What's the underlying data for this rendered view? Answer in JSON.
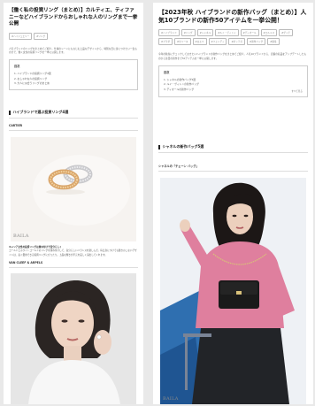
{
  "left_article": {
    "title": "【働く私の投資リング（まとめ）】カルティエ、ティファニーなどハイブランドからおしゃれな人のリングまで一挙公開",
    "tags": [
      "#ハイジュエリー",
      "#リング"
    ],
    "lead": "人気ブランドのリングをまとめてご紹介。仕事のシーンにもなじむ上品なデザインから、特別な日に身につけたい一生ものまで、働く女性の投資リングを一挙に公開します。",
    "toc": {
      "heading": "目次",
      "items": [
        "1. ハイブランドの投資リング4選",
        "2. おしゃれな人の投資リング",
        "3. 大人に似合うリングのまとめ"
      ]
    },
    "section1": "ハイブランドで選ぶ投資リング4選",
    "sub1": "CARTIER",
    "photo1_logo": "BAILA",
    "caption1": {
      "bold": "キャリア女性の投資リングは重ね付けで自分らしく",
      "text": "ゴールドとホワイトゴールドのリングを重ね付けして、自分らしいバランスを楽しんで。毎日身につけても飽きのこないデザインは、長く愛用できる投資リングにぴったり。上品な輝きが手元を美しく演出してくれます。"
    },
    "sub2": "VAN CLEEF & ARPELS"
  },
  "right_article": {
    "title": "【2023年秋 ハイブランドの新作バッグ（まとめ）】人気10ブランドの新作50アイテムを一挙公開！",
    "tags": [
      "#ハイブランド",
      "#バッグ",
      "#シャネル",
      "#ルイ・ヴィトン",
      "#ディオール",
      "#エルメス",
      "#グッチ",
      "#プラダ",
      "#セリーヌ",
      "#ロエベ",
      "#フェンディ",
      "#ボッテガ",
      "#新作バッグ",
      "#秋冬"
    ],
    "lead": "今年の秋冬にチェックしておきたいハイブランドの新作バッグをまとめてご紹介。人気10ブランドから、定番の名品をアップデートしたものから注目の新作まで50アイテムを一挙に公開します。",
    "toc": {
      "heading": "目次",
      "items": [
        "1. シャネルの新作バッグ5選",
        "2. ルイ・ヴィトンの新作バッグ",
        "3. ディオールの新作バッグ"
      ],
      "more": "すべて見る"
    },
    "section1": "シャネルの新作バッグ5選",
    "sub1": "シャネルの「チェーン バッグ」",
    "photo1_logo": "BAILA"
  },
  "colors": {
    "background": "#e9e9e9",
    "card": "#ffffff",
    "text": "#222222",
    "sweater": "#df7f9e",
    "bag": "#1a1a1a"
  },
  "icons": [
    "section-bar-icon"
  ]
}
